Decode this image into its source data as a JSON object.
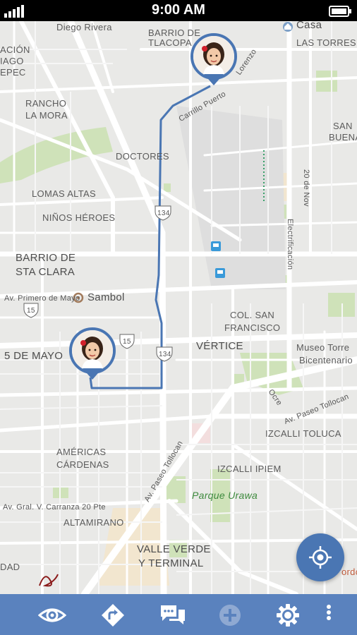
{
  "status_bar": {
    "time": "9:00 AM"
  },
  "map": {
    "labels": {
      "diego_rivera": "Diego Rivera",
      "barrio_tlacopa_1": "BARRIO DE",
      "barrio_tlacopa_2": "TLACOPA",
      "casa": "Casa",
      "las_torres": "LAS TORRES",
      "acion": "ACIÓN",
      "iago": "IAGO",
      "epec": "EPEC",
      "lorenzo": "Lorenzo",
      "rancho_1": "RANCHO",
      "rancho_2": "LA MORA",
      "san_1": "SAN",
      "san_2": "BUENA",
      "doctores": "DOCTORES",
      "carrillo": "Carrillo Puerto",
      "nov20": "20 de Nov",
      "lomas": "LOMAS ALTAS",
      "ninos": "NIÑOS HÉROES",
      "estrificacion": "Electrificación",
      "barrio_sta_1": "BARRIO DE",
      "barrio_sta_2": "STA CLARA",
      "primero_mayo": "Av. Primero de Mayo",
      "sambol": "Sambol",
      "col_san_1": "COL. SAN",
      "col_san_2": "FRANCISCO",
      "cinco_mayo": "5 DE MAYO",
      "vertice": "VÉRTICE",
      "museo_1": "Museo Torre",
      "museo_2": "Bicentenario",
      "ocre": "Ocre",
      "paseo_tollocan_1": "Av. Paseo Tollocan",
      "izcalli_toluca": "IZCALLI TOLUCA",
      "americas_1": "AMÉRICAS",
      "americas_2": "CÁRDENAS",
      "paseo_tollocan_2": "Av. Paseo Tollocan",
      "izcalli_ipiem": "IZCALLI IPIEM",
      "parque": "Parque Urawa",
      "carranza": "Av. Gral. V. Carranza 20 Pte",
      "altamirano": "ALTAMIRANO",
      "valle_1": "VALLE VERDE",
      "valle_2": "Y TERMINAL",
      "dad": "DAD",
      "orde": "ordo",
      "shield_15a": "15",
      "shield_15b": "15",
      "shield_134a": "134",
      "shield_134b": "134"
    },
    "markers": [
      {
        "name": "child-location-marker-top",
        "icon": "child-avatar"
      },
      {
        "name": "child-location-marker-bottom",
        "icon": "child-avatar"
      }
    ],
    "route_color": "#4a76b3"
  },
  "fab": {
    "icon": "my-location-icon"
  },
  "bottom_nav": [
    {
      "icon": "eye-icon"
    },
    {
      "icon": "directions-icon"
    },
    {
      "icon": "chat-icon"
    },
    {
      "icon": "add-icon"
    },
    {
      "icon": "settings-icon"
    },
    {
      "icon": "more-vertical-icon"
    }
  ],
  "colors": {
    "accent": "#4a76b3",
    "bar": "#5a82be",
    "park": "#cfe2b9",
    "road": "#ffffff",
    "map_bg": "#e9e9e7"
  }
}
